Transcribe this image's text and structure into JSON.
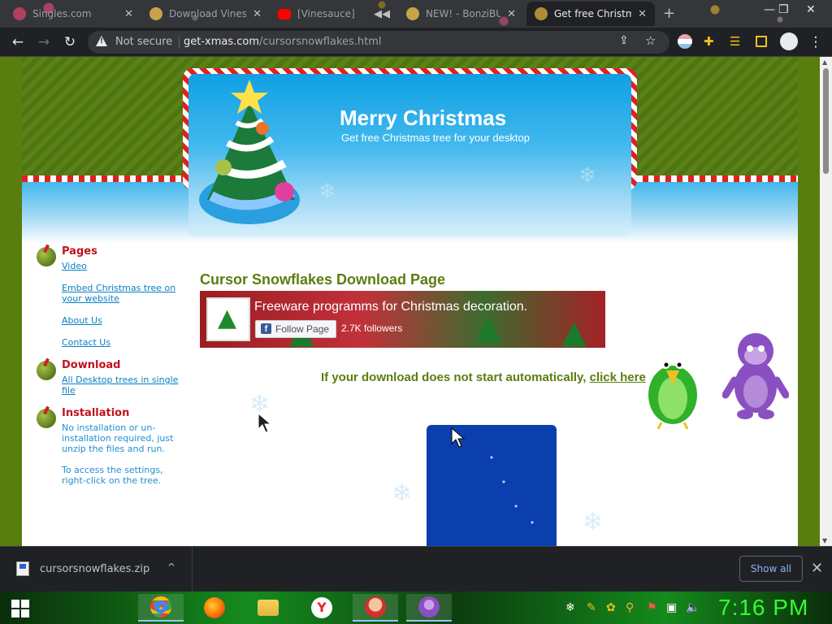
{
  "tabs": [
    {
      "title": "Singles.com",
      "close": "✕"
    },
    {
      "title": "Download Vinesauce",
      "close": "✕"
    },
    {
      "title": "[Vinesauce]",
      "close": "✕"
    },
    {
      "title": "NEW! - BonziBUDDY",
      "close": "✕"
    },
    {
      "title": "Get free Christmas",
      "close": "✕"
    }
  ],
  "new_tab": "+",
  "window_controls": {
    "minimize": "—",
    "maximize": "❐",
    "close": "✕"
  },
  "toolbar": {
    "back": "←",
    "forward": "→",
    "reload": "↻",
    "security": "Not secure",
    "url_host": "get-xmas.com",
    "url_path": "/cursorsnowflakes.html",
    "share": "⇪",
    "star": "☆",
    "menu": "⋮"
  },
  "site": {
    "banner": {
      "title": "Merry Christmas",
      "subtitle": "Get free Christmas tree for your desktop"
    },
    "sidebar": {
      "pages": {
        "heading": "Pages",
        "links": [
          "Video",
          "Embed Christmas tree on your website",
          "About Us",
          "Contact Us"
        ]
      },
      "download": {
        "heading": "Download",
        "links": [
          "All Desktop trees in single file"
        ]
      },
      "installation": {
        "heading": "Installation",
        "text1": "No installation or un-installation required, just unzip the files and run.",
        "text2": "To access the settings, right-click on the tree."
      }
    },
    "main_title": "Cursor Snowflakes Download Page",
    "facebook": {
      "page_name": "Freeware programms for Christmas decoration.",
      "follow_label": "Follow Page",
      "followers": "2.7K followers"
    },
    "download_note": "If your download does not start automatically, ",
    "download_link": "click here"
  },
  "download_bar": {
    "file": "cursorsnowflakes.zip",
    "chevron": "^",
    "show_all": "Show all",
    "close": "✕"
  },
  "taskbar": {
    "clock": "7:16 PM",
    "tray_icons": [
      "snowflake-icon",
      "brush-icon",
      "ornament-icon",
      "search-icon",
      "flag-icon",
      "network-icon",
      "volume-icon"
    ]
  },
  "colors": {
    "page_green": "#5a7d10",
    "heading_red": "#c1121f",
    "link_blue": "#0b7fc4",
    "title_green": "#5b7d10",
    "clock_green": "#32ff32"
  }
}
